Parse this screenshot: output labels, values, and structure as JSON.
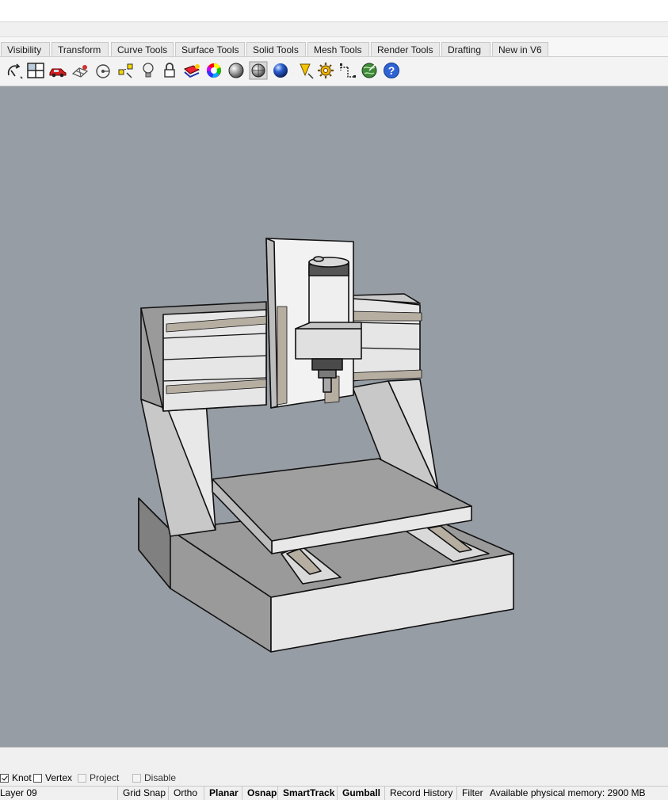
{
  "tabs": [
    {
      "label": "Visibility"
    },
    {
      "label": "Transform"
    },
    {
      "label": "Curve Tools"
    },
    {
      "label": "Surface Tools"
    },
    {
      "label": "Solid Tools"
    },
    {
      "label": "Mesh Tools"
    },
    {
      "label": "Render Tools"
    },
    {
      "label": "Drafting"
    },
    {
      "label": "New in V6"
    }
  ],
  "toolbar_icons": [
    "lasso-rotate-icon",
    "four-viewports-icon",
    "car-render-icon",
    "wireframe-object-icon",
    "circle-target-icon",
    "select-points-icon",
    "light-bulb-icon",
    "lock-icon",
    "layer-paint-icon",
    "color-wheel-icon",
    "shaded-sphere-icon",
    "ghosted-sphere-icon",
    "rendered-sphere-icon",
    "cone-light-icon",
    "settings-gear-icon",
    "dimension-icon",
    "globe-icon",
    "help-icon"
  ],
  "osnap": {
    "knot": {
      "label": "Knot",
      "checked": true
    },
    "vertex": {
      "label": "Vertex",
      "checked": false
    },
    "project": {
      "label": "Project",
      "checked": false,
      "disabled": true
    },
    "disable": {
      "label": "Disable",
      "checked": false,
      "disabled": true
    }
  },
  "status": {
    "layer": "Layer 09",
    "grid_snap": "Grid Snap",
    "ortho": "Ortho",
    "planar": "Planar",
    "osnap": "Osnap",
    "smarttrack": "SmartTrack",
    "gumball": "Gumball",
    "record_history": "Record History",
    "filter": "Filter",
    "memory": "Available physical memory: 2900 MB"
  },
  "colors": {
    "viewport_bg": "#979da5",
    "model_light": "#e8e8e8",
    "model_mid": "#c4c4c4",
    "model_dark": "#8f8f8f",
    "rail": "#b7aea2"
  }
}
